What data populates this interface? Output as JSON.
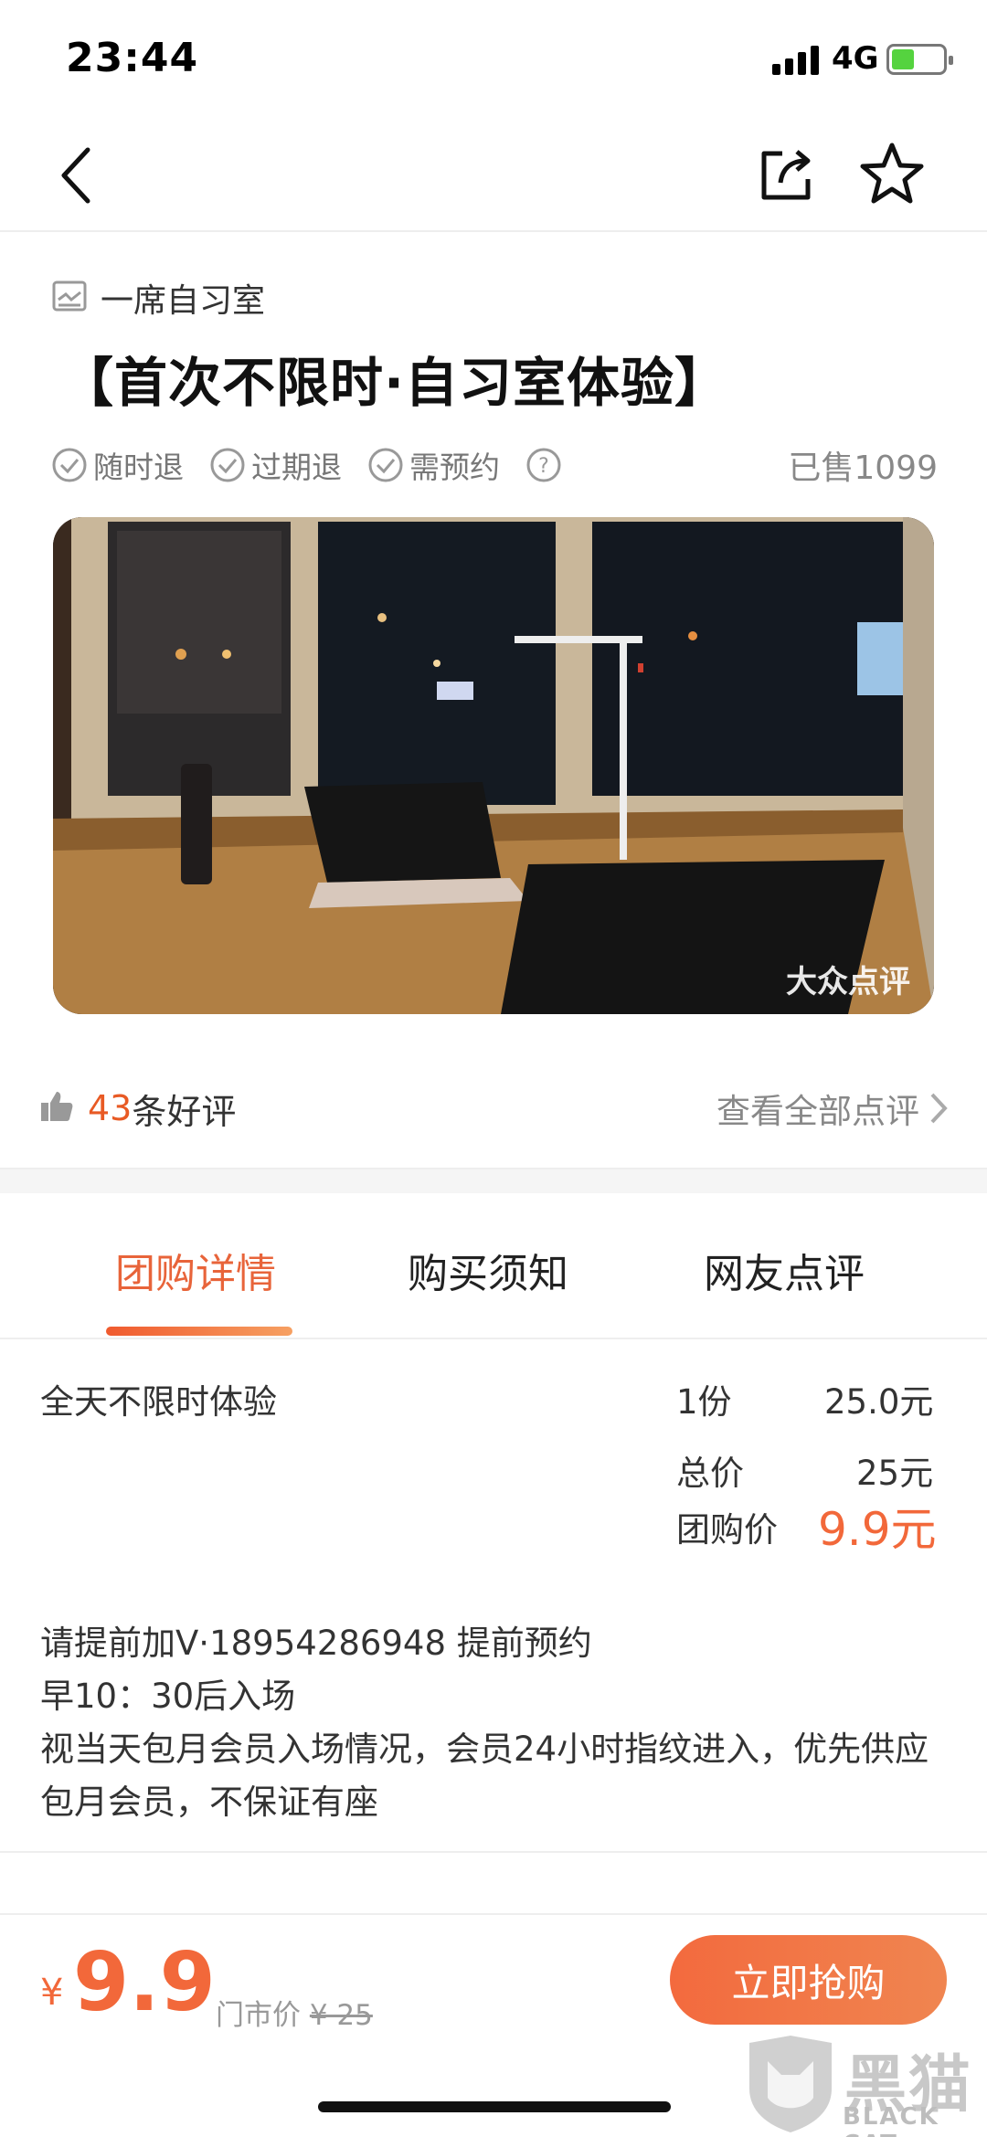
{
  "status_bar": {
    "time": "23:44",
    "network": "4G"
  },
  "shop": {
    "name": "一席自习室",
    "icon": "store-icon"
  },
  "deal": {
    "title": "【首次不限时·自习室体验】",
    "tags": [
      "随时退",
      "过期退",
      "需预约"
    ],
    "sold": "已售1099"
  },
  "photo": {
    "watermark": "大众点评"
  },
  "reviews": {
    "count": "43",
    "label": "条好评",
    "view_all": "查看全部点评"
  },
  "tabs": [
    "团购详情",
    "购买须知",
    "网友点评"
  ],
  "package": {
    "item_name": "全天不限时体验",
    "quantity": "1份",
    "item_price": "25.0元",
    "total_label": "总价",
    "total_value": "25元",
    "group_label": "团购价",
    "group_value": "9.9元"
  },
  "notes": [
    "请提前加V·18954286948 提前预约",
    "早10：30后入场",
    "视当天包月会员入场情况，会员24小时指纹进入，优先供应包月会员，不保证有座"
  ],
  "bottom": {
    "currency": "¥",
    "price": "9.9",
    "market_label": "门市价",
    "market_price": "¥ 25",
    "buy_label": "立即抢购"
  },
  "corner_watermark": {
    "cn": "黑猫",
    "en": "BLACK CAT"
  },
  "colors": {
    "accent": "#f2683a",
    "text": "#222222",
    "muted": "#888888"
  }
}
